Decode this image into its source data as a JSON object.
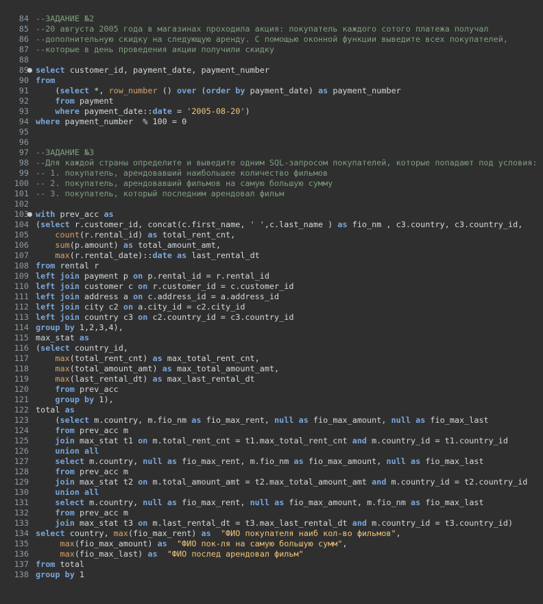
{
  "editor": {
    "lines": [
      {
        "num": "84",
        "fold": false,
        "tokens": [
          [
            "c",
            "--ЗАДАНИЕ №2"
          ]
        ]
      },
      {
        "num": "85",
        "fold": false,
        "tokens": [
          [
            "c",
            "--20 августа 2005 года в магазинах проходила акция: покупатель каждого сотого платежа получал"
          ]
        ]
      },
      {
        "num": "86",
        "fold": false,
        "tokens": [
          [
            "c",
            "--дополнительную скидку на следующую аренду. С помощью оконной функции выведите всех покупателей,"
          ]
        ]
      },
      {
        "num": "87",
        "fold": false,
        "tokens": [
          [
            "c",
            "--которые в день проведения акции получили скидку"
          ]
        ]
      },
      {
        "num": "88",
        "fold": false,
        "tokens": []
      },
      {
        "num": "89",
        "fold": true,
        "tokens": [
          [
            "k",
            "select"
          ],
          [
            "i",
            " customer_id, payment_date, payment_number"
          ]
        ]
      },
      {
        "num": "90",
        "fold": false,
        "tokens": [
          [
            "k",
            "from"
          ]
        ]
      },
      {
        "num": "91",
        "fold": false,
        "tokens": [
          [
            "i",
            "    ("
          ],
          [
            "k",
            "select"
          ],
          [
            "i",
            " *, "
          ],
          [
            "f",
            "row_number"
          ],
          [
            "i",
            " () "
          ],
          [
            "k",
            "over"
          ],
          [
            "i",
            " ("
          ],
          [
            "k",
            "order by"
          ],
          [
            "i",
            " payment_date) "
          ],
          [
            "k",
            "as"
          ],
          [
            "i",
            " payment_number"
          ]
        ]
      },
      {
        "num": "92",
        "fold": false,
        "tokens": [
          [
            "i",
            "    "
          ],
          [
            "k",
            "from"
          ],
          [
            "i",
            " payment"
          ]
        ]
      },
      {
        "num": "93",
        "fold": false,
        "tokens": [
          [
            "i",
            "    "
          ],
          [
            "k",
            "where"
          ],
          [
            "i",
            " payment_date::"
          ],
          [
            "k",
            "date"
          ],
          [
            "i",
            " = "
          ],
          [
            "s",
            "'2005-08-20'"
          ],
          [
            "i",
            ")"
          ]
        ]
      },
      {
        "num": "94",
        "fold": false,
        "tokens": [
          [
            "k",
            "where"
          ],
          [
            "i",
            " payment_number  % 100 = 0"
          ]
        ]
      },
      {
        "num": "95",
        "fold": false,
        "tokens": []
      },
      {
        "num": "96",
        "fold": false,
        "tokens": []
      },
      {
        "num": "97",
        "fold": false,
        "tokens": [
          [
            "c",
            "--ЗАДАНИЕ №3"
          ]
        ]
      },
      {
        "num": "98",
        "fold": false,
        "tokens": [
          [
            "c",
            "--Для каждой страны определите и выведите одним SQL-запросом покупателей, которые попадают под условия:"
          ]
        ]
      },
      {
        "num": "99",
        "fold": false,
        "tokens": [
          [
            "c",
            "-- 1. покупатель, арендовавший наибольшее количество фильмов"
          ]
        ]
      },
      {
        "num": "100",
        "fold": false,
        "tokens": [
          [
            "c",
            "-- 2. покупатель, арендовавший фильмов на самую большую сумму"
          ]
        ]
      },
      {
        "num": "101",
        "fold": false,
        "tokens": [
          [
            "c",
            "-- 3. покупатель, который последним арендовал фильм"
          ]
        ]
      },
      {
        "num": "102",
        "fold": false,
        "tokens": []
      },
      {
        "num": "103",
        "fold": true,
        "tokens": [
          [
            "k",
            "with"
          ],
          [
            "i",
            " prev_acc "
          ],
          [
            "k",
            "as"
          ]
        ]
      },
      {
        "num": "104",
        "fold": false,
        "tokens": [
          [
            "i",
            "("
          ],
          [
            "k",
            "select"
          ],
          [
            "i",
            " r.customer_id, concat(c.first_name, "
          ],
          [
            "s",
            "' '"
          ],
          [
            "i",
            ",c.last_name ) "
          ],
          [
            "k",
            "as"
          ],
          [
            "i",
            " fio_nm , c3.country, c3.country_id,"
          ]
        ]
      },
      {
        "num": "105",
        "fold": false,
        "tokens": [
          [
            "i",
            "    "
          ],
          [
            "f",
            "count"
          ],
          [
            "i",
            "(r.rental_id) "
          ],
          [
            "k",
            "as"
          ],
          [
            "i",
            " total_rent_cnt,"
          ]
        ]
      },
      {
        "num": "106",
        "fold": false,
        "tokens": [
          [
            "i",
            "    "
          ],
          [
            "f",
            "sum"
          ],
          [
            "i",
            "(p.amount) "
          ],
          [
            "k",
            "as"
          ],
          [
            "i",
            " total_amount_amt,"
          ]
        ]
      },
      {
        "num": "107",
        "fold": false,
        "tokens": [
          [
            "i",
            "    "
          ],
          [
            "f",
            "max"
          ],
          [
            "i",
            "(r.rental_date)::"
          ],
          [
            "k",
            "date"
          ],
          [
            "i",
            " "
          ],
          [
            "k",
            "as"
          ],
          [
            "i",
            " last_rental_dt"
          ]
        ]
      },
      {
        "num": "108",
        "fold": false,
        "tokens": [
          [
            "k",
            "from"
          ],
          [
            "i",
            " rental r"
          ]
        ]
      },
      {
        "num": "109",
        "fold": false,
        "tokens": [
          [
            "k",
            "left join"
          ],
          [
            "i",
            " payment p "
          ],
          [
            "k",
            "on"
          ],
          [
            "i",
            " p.rental_id = r.rental_id"
          ]
        ]
      },
      {
        "num": "110",
        "fold": false,
        "tokens": [
          [
            "k",
            "left join"
          ],
          [
            "i",
            " customer c "
          ],
          [
            "k",
            "on"
          ],
          [
            "i",
            " r.customer_id = c.customer_id"
          ]
        ]
      },
      {
        "num": "111",
        "fold": false,
        "tokens": [
          [
            "k",
            "left join"
          ],
          [
            "i",
            " address a "
          ],
          [
            "k",
            "on"
          ],
          [
            "i",
            " c.address_id = a.address_id"
          ]
        ]
      },
      {
        "num": "112",
        "fold": false,
        "tokens": [
          [
            "k",
            "left join"
          ],
          [
            "i",
            " city c2 "
          ],
          [
            "k",
            "on"
          ],
          [
            "i",
            " a.city_id = c2.city_id"
          ]
        ]
      },
      {
        "num": "113",
        "fold": false,
        "tokens": [
          [
            "k",
            "left join"
          ],
          [
            "i",
            " country c3 "
          ],
          [
            "k",
            "on"
          ],
          [
            "i",
            " c2.country_id = c3.country_id"
          ]
        ]
      },
      {
        "num": "114",
        "fold": false,
        "tokens": [
          [
            "k",
            "group by"
          ],
          [
            "i",
            " 1,2,3,4),"
          ]
        ]
      },
      {
        "num": "115",
        "fold": false,
        "tokens": [
          [
            "i",
            "max_stat "
          ],
          [
            "k",
            "as"
          ]
        ]
      },
      {
        "num": "116",
        "fold": false,
        "tokens": [
          [
            "i",
            "("
          ],
          [
            "k",
            "select"
          ],
          [
            "i",
            " country_id,"
          ]
        ]
      },
      {
        "num": "117",
        "fold": false,
        "tokens": [
          [
            "i",
            "    "
          ],
          [
            "f",
            "max"
          ],
          [
            "i",
            "(total_rent_cnt) "
          ],
          [
            "k",
            "as"
          ],
          [
            "i",
            " max_total_rent_cnt,"
          ]
        ]
      },
      {
        "num": "118",
        "fold": false,
        "tokens": [
          [
            "i",
            "    "
          ],
          [
            "f",
            "max"
          ],
          [
            "i",
            "(total_amount_amt) "
          ],
          [
            "k",
            "as"
          ],
          [
            "i",
            " max_total_amount_amt,"
          ]
        ]
      },
      {
        "num": "119",
        "fold": false,
        "tokens": [
          [
            "i",
            "    "
          ],
          [
            "f",
            "max"
          ],
          [
            "i",
            "(last_rental_dt) "
          ],
          [
            "k",
            "as"
          ],
          [
            "i",
            " max_last_rental_dt"
          ]
        ]
      },
      {
        "num": "120",
        "fold": false,
        "tokens": [
          [
            "i",
            "    "
          ],
          [
            "k",
            "from"
          ],
          [
            "i",
            " prev_acc"
          ]
        ]
      },
      {
        "num": "121",
        "fold": false,
        "tokens": [
          [
            "i",
            "    "
          ],
          [
            "k",
            "group by"
          ],
          [
            "i",
            " 1),"
          ]
        ]
      },
      {
        "num": "122",
        "fold": false,
        "tokens": [
          [
            "i",
            "total "
          ],
          [
            "k",
            "as"
          ]
        ]
      },
      {
        "num": "123",
        "fold": false,
        "tokens": [
          [
            "i",
            "    ("
          ],
          [
            "k",
            "select"
          ],
          [
            "i",
            " m.country, m.fio_nm "
          ],
          [
            "k",
            "as"
          ],
          [
            "i",
            " fio_max_rent, "
          ],
          [
            "k",
            "null"
          ],
          [
            "i",
            " "
          ],
          [
            "k",
            "as"
          ],
          [
            "i",
            " fio_max_amount, "
          ],
          [
            "k",
            "null"
          ],
          [
            "i",
            " "
          ],
          [
            "k",
            "as"
          ],
          [
            "i",
            " fio_max_last"
          ]
        ]
      },
      {
        "num": "124",
        "fold": false,
        "tokens": [
          [
            "i",
            "    "
          ],
          [
            "k",
            "from"
          ],
          [
            "i",
            " prev_acc m"
          ]
        ]
      },
      {
        "num": "125",
        "fold": false,
        "tokens": [
          [
            "i",
            "    "
          ],
          [
            "k",
            "join"
          ],
          [
            "i",
            " max_stat t1 "
          ],
          [
            "k",
            "on"
          ],
          [
            "i",
            " m.total_rent_cnt = t1.max_total_rent_cnt "
          ],
          [
            "k",
            "and"
          ],
          [
            "i",
            " m.country_id = t1.country_id"
          ]
        ]
      },
      {
        "num": "126",
        "fold": false,
        "tokens": [
          [
            "i",
            "    "
          ],
          [
            "k",
            "union all"
          ]
        ]
      },
      {
        "num": "127",
        "fold": false,
        "tokens": [
          [
            "i",
            "    "
          ],
          [
            "k",
            "select"
          ],
          [
            "i",
            " m.country, "
          ],
          [
            "k",
            "null"
          ],
          [
            "i",
            " "
          ],
          [
            "k",
            "as"
          ],
          [
            "i",
            " fio_max_rent, m.fio_nm "
          ],
          [
            "k",
            "as"
          ],
          [
            "i",
            " fio_max_amount, "
          ],
          [
            "k",
            "null"
          ],
          [
            "i",
            " "
          ],
          [
            "k",
            "as"
          ],
          [
            "i",
            " fio_max_last"
          ]
        ]
      },
      {
        "num": "128",
        "fold": false,
        "tokens": [
          [
            "i",
            "    "
          ],
          [
            "k",
            "from"
          ],
          [
            "i",
            " prev_acc m"
          ]
        ]
      },
      {
        "num": "129",
        "fold": false,
        "tokens": [
          [
            "i",
            "    "
          ],
          [
            "k",
            "join"
          ],
          [
            "i",
            " max_stat t2 "
          ],
          [
            "k",
            "on"
          ],
          [
            "i",
            " m.total_amount_amt = t2.max_total_amount_amt "
          ],
          [
            "k",
            "and"
          ],
          [
            "i",
            " m.country_id = t2.country_id"
          ]
        ]
      },
      {
        "num": "130",
        "fold": false,
        "tokens": [
          [
            "i",
            "    "
          ],
          [
            "k",
            "union all"
          ]
        ]
      },
      {
        "num": "131",
        "fold": false,
        "tokens": [
          [
            "i",
            "    "
          ],
          [
            "k",
            "select"
          ],
          [
            "i",
            " m.country, "
          ],
          [
            "k",
            "null"
          ],
          [
            "i",
            " "
          ],
          [
            "k",
            "as"
          ],
          [
            "i",
            " fio_max_rent, "
          ],
          [
            "k",
            "null"
          ],
          [
            "i",
            " "
          ],
          [
            "k",
            "as"
          ],
          [
            "i",
            " fio_max_amount, m.fio_nm "
          ],
          [
            "k",
            "as"
          ],
          [
            "i",
            " fio_max_last"
          ]
        ]
      },
      {
        "num": "132",
        "fold": false,
        "tokens": [
          [
            "i",
            "    "
          ],
          [
            "k",
            "from"
          ],
          [
            "i",
            " prev_acc m"
          ]
        ]
      },
      {
        "num": "133",
        "fold": false,
        "tokens": [
          [
            "i",
            "    "
          ],
          [
            "k",
            "join"
          ],
          [
            "i",
            " max_stat t3 "
          ],
          [
            "k",
            "on"
          ],
          [
            "i",
            " m.last_rental_dt = t3.max_last_rental_dt "
          ],
          [
            "k",
            "and"
          ],
          [
            "i",
            " m.country_id = t3.country_id)"
          ]
        ]
      },
      {
        "num": "134",
        "fold": false,
        "tokens": [
          [
            "k",
            "select"
          ],
          [
            "i",
            " country, "
          ],
          [
            "f",
            "max"
          ],
          [
            "i",
            "(fio_max_rent) "
          ],
          [
            "k",
            "as"
          ],
          [
            "i",
            "  "
          ],
          [
            "s",
            "\"ФИО покупателя наиб кол-во фильмов\""
          ],
          [
            "i",
            ","
          ]
        ]
      },
      {
        "num": "135",
        "fold": false,
        "tokens": [
          [
            "i",
            "     "
          ],
          [
            "f",
            "max"
          ],
          [
            "i",
            "(fio_max_amount) "
          ],
          [
            "k",
            "as"
          ],
          [
            "i",
            "  "
          ],
          [
            "s",
            "\"ФИО пок-ля на самую большую сумм\""
          ],
          [
            "i",
            ","
          ]
        ]
      },
      {
        "num": "136",
        "fold": false,
        "tokens": [
          [
            "i",
            "     "
          ],
          [
            "f",
            "max"
          ],
          [
            "i",
            "(fio_max_last) "
          ],
          [
            "k",
            "as"
          ],
          [
            "i",
            "  "
          ],
          [
            "s",
            "\"ФИО послед арендовал фильм\""
          ]
        ]
      },
      {
        "num": "137",
        "fold": false,
        "tokens": [
          [
            "k",
            "from"
          ],
          [
            "i",
            " total"
          ]
        ]
      },
      {
        "num": "138",
        "fold": false,
        "tokens": [
          [
            "k",
            "group by"
          ],
          [
            "i",
            " 1"
          ]
        ]
      }
    ]
  }
}
